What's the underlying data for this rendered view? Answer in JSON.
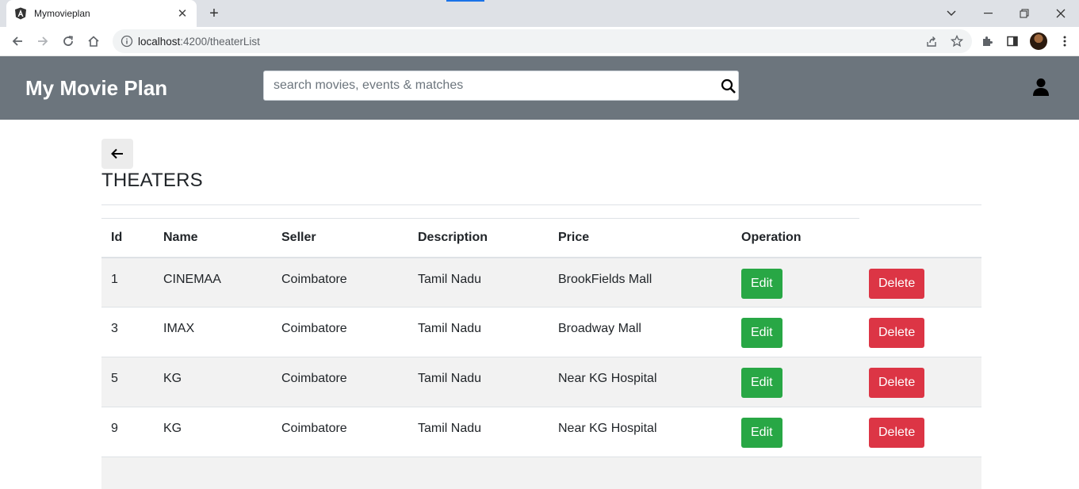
{
  "browser": {
    "tab_title": "Mymovieplan",
    "url_host": "localhost",
    "url_path": ":4200/theaterList"
  },
  "app": {
    "brand": "My Movie Plan",
    "search_placeholder": "search movies, events & matches",
    "accent_header": "#6c757d"
  },
  "page": {
    "title": "THEATERS"
  },
  "table": {
    "columns": [
      "Id",
      "Name",
      "Seller",
      "Description",
      "Price",
      "Operation"
    ],
    "rows": [
      {
        "id": "1",
        "name": "CINEMAA",
        "seller": "Coimbatore",
        "description": "Tamil Nadu",
        "price": "BrookFields Mall"
      },
      {
        "id": "3",
        "name": "IMAX",
        "seller": "Coimbatore",
        "description": "Tamil Nadu",
        "price": "Broadway Mall"
      },
      {
        "id": "5",
        "name": "KG",
        "seller": "Coimbatore",
        "description": "Tamil Nadu",
        "price": "Near KG Hospital"
      },
      {
        "id": "9",
        "name": "KG",
        "seller": "Coimbatore",
        "description": "Tamil Nadu",
        "price": "Near KG Hospital"
      }
    ],
    "edit_label": "Edit",
    "delete_label": "Delete"
  },
  "colors": {
    "edit": "#28a745",
    "delete": "#dc3545"
  }
}
